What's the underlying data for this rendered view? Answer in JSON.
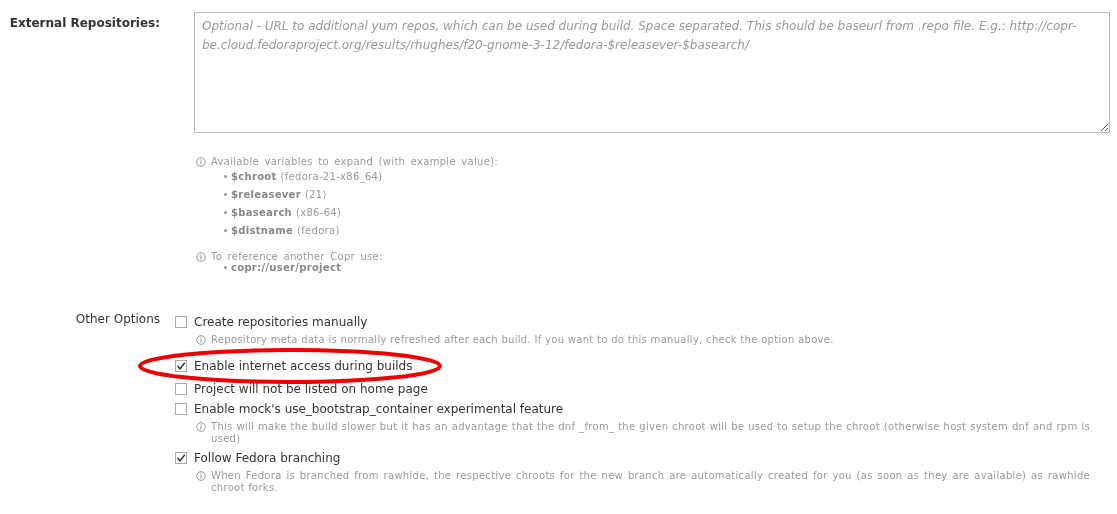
{
  "external_repositories": {
    "label": "External Repositories:",
    "placeholder": "Optional - URL to additional yum repos, which can be used during build. Space separated. This should be baseurl from .repo file. E.g.: http://copr-be.cloud.fedoraproject.org/results/rhughes/f20-gnome-3-12/fedora-$releasever-$basearch/"
  },
  "help": [
    {
      "text": "Available variables to expand (with example value):",
      "items": [
        {
          "name": "$chroot",
          "example": "(fedora-21-x86_64)"
        },
        {
          "name": "$releasever",
          "example": "(21)"
        },
        {
          "name": "$basearch",
          "example": "(x86-64)"
        },
        {
          "name": "$distname",
          "example": "(fedora)"
        }
      ]
    },
    {
      "text": "To reference another Copr use:",
      "items": [
        {
          "name": "copr://user/project"
        }
      ]
    }
  ],
  "other_options": {
    "label": "Other Options",
    "options": [
      {
        "label": "Create repositories manually",
        "checked": false,
        "hint": "Repository meta data is normally refreshed after each build. If you want to do this manually, check the option above."
      },
      {
        "label": "Enable internet access during builds",
        "checked": true,
        "circled": true
      },
      {
        "label": "Project will not be listed on home page",
        "checked": false
      },
      {
        "label": "Enable mock's use_bootstrap_container experimental feature",
        "checked": false,
        "hint": "This will make the build slower but it has an advantage that the dnf _from_ the given chroot will be used to setup the chroot (otherwise host system dnf and rpm is used)"
      },
      {
        "label": "Follow Fedora branching",
        "checked": true,
        "hint": "When Fedora is branched from rawhide, the respective chroots for the new branch are automatically created for you (as soon as they are available) as rawhide chroot forks."
      }
    ]
  }
}
